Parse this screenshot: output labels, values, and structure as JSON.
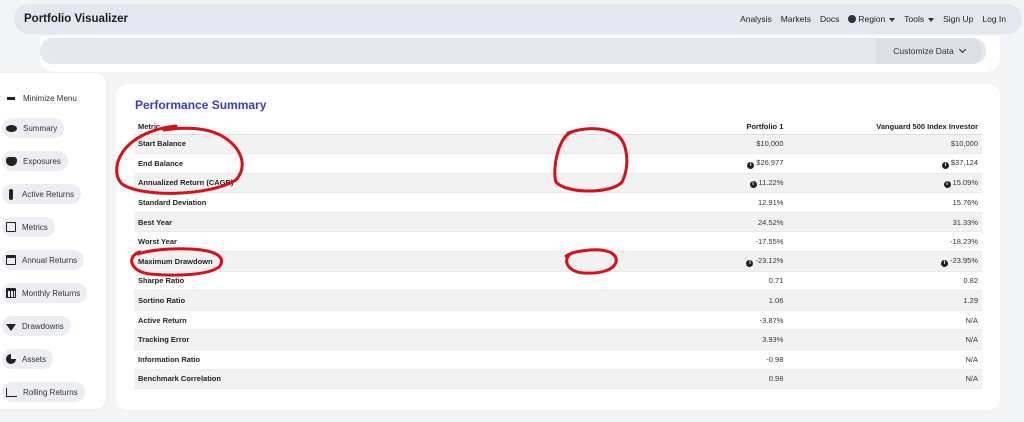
{
  "navbar": {
    "brand": "Portfolio Visualizer",
    "links": [
      "Analysis",
      "Markets",
      "Docs",
      "Region",
      "Tools",
      "Sign Up",
      "Log In"
    ]
  },
  "toolbar": {
    "customize_label": "Customize Data"
  },
  "sidebar": {
    "items": [
      {
        "label": "Minimize Menu",
        "icon": "minus-icon"
      },
      {
        "label": "Summary",
        "icon": "eye-icon"
      },
      {
        "label": "Exposures",
        "icon": "cubes-icon"
      },
      {
        "label": "Active Returns",
        "icon": "thermometer-icon"
      },
      {
        "label": "Metrics",
        "icon": "check-square-icon"
      },
      {
        "label": "Annual Returns",
        "icon": "calendar-icon"
      },
      {
        "label": "Monthly Returns",
        "icon": "calendar-grid-icon"
      },
      {
        "label": "Drawdowns",
        "icon": "arrow-down-icon"
      },
      {
        "label": "Assets",
        "icon": "pie-chart-icon"
      },
      {
        "label": "Rolling Returns",
        "icon": "line-chart-icon"
      }
    ]
  },
  "summary": {
    "title": "Performance Summary",
    "headers": [
      "Metric",
      "Portfolio 1",
      "Vanguard 500 Index Investor"
    ],
    "rows": [
      {
        "metric": "Start Balance",
        "p1": "$10,000",
        "v": "$10,000",
        "p1_info": false,
        "v_info": false
      },
      {
        "metric": "End Balance",
        "p1": "$26,977",
        "v": "$37,124",
        "p1_info": true,
        "v_info": true
      },
      {
        "metric": "Annualized Return (CAGR)",
        "p1": "11.22%",
        "v": "15.09%",
        "p1_info": true,
        "v_info": true
      },
      {
        "metric": "Standard Deviation",
        "p1": "12.91%",
        "v": "15.76%",
        "p1_info": false,
        "v_info": false
      },
      {
        "metric": "Best Year",
        "p1": "24.52%",
        "v": "31.33%",
        "p1_info": false,
        "v_info": false
      },
      {
        "metric": "Worst Year",
        "p1": "-17.55%",
        "v": "-18.23%",
        "p1_info": false,
        "v_info": false
      },
      {
        "metric": "Maximum Drawdown",
        "p1": "-23.12%",
        "v": "-23.95%",
        "p1_info": true,
        "v_info": true
      },
      {
        "metric": "Sharpe Ratio",
        "p1": "0.71",
        "v": "0.82",
        "p1_info": false,
        "v_info": false
      },
      {
        "metric": "Sortino Ratio",
        "p1": "1.06",
        "v": "1.29",
        "p1_info": false,
        "v_info": false
      },
      {
        "metric": "Active Return",
        "p1": "-3.87%",
        "v": "N/A",
        "p1_info": false,
        "v_info": false
      },
      {
        "metric": "Tracking Error",
        "p1": "3.93%",
        "v": "N/A",
        "p1_info": false,
        "v_info": false
      },
      {
        "metric": "Information Ratio",
        "p1": "-0.98",
        "v": "N/A",
        "p1_info": false,
        "v_info": false
      },
      {
        "metric": "Benchmark Correlation",
        "p1": "0.98",
        "v": "N/A",
        "p1_info": false,
        "v_info": false
      }
    ]
  },
  "annotation_color": "#d8101a",
  "accent_color": "#3b3bbf"
}
